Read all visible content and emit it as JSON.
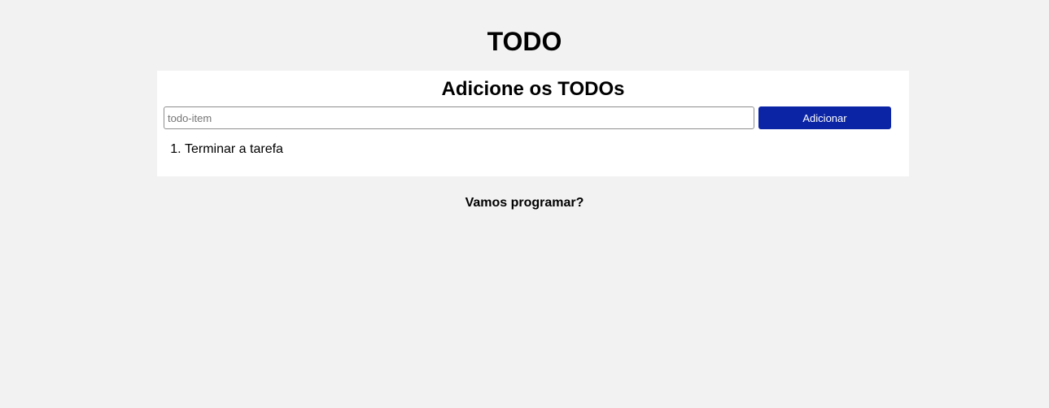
{
  "header": {
    "title": "TODO"
  },
  "card": {
    "title": "Adicione os TODOs",
    "input": {
      "placeholder": "todo-item",
      "value": ""
    },
    "add_button_label": "Adicionar",
    "items": [
      {
        "label": "Terminar a tarefa"
      }
    ]
  },
  "footer": {
    "text": "Vamos programar?"
  },
  "colors": {
    "background": "#f2f2f2",
    "card_background": "#ffffff",
    "button_background": "#0b24a5",
    "button_text": "#ffffff"
  }
}
